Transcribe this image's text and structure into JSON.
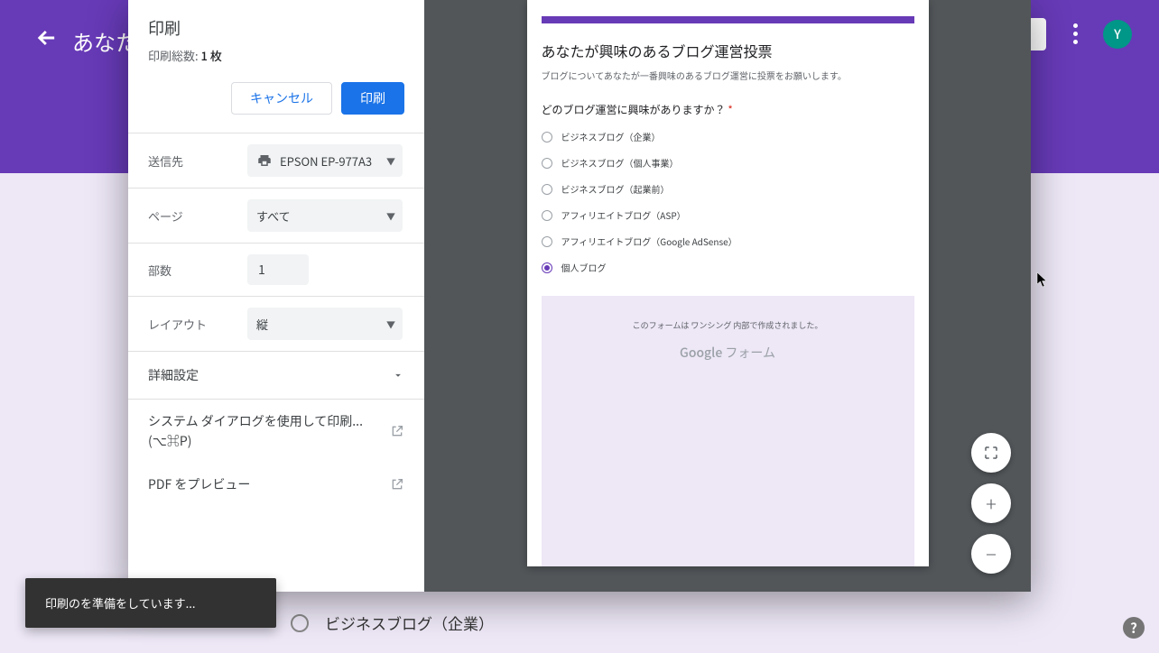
{
  "header": {
    "title": "あなた",
    "avatar_letter": "Y"
  },
  "visible_option": "ビジネスブログ（企業）",
  "toast": "印刷のを準備をしています...",
  "print": {
    "title": "印刷",
    "subtitle_prefix": "印刷総数: ",
    "subtitle_count": "1 枚",
    "cancel": "キャンセル",
    "confirm": "印刷",
    "rows": {
      "destination_label": "送信先",
      "destination_value": "EPSON EP-977A3",
      "pages_label": "ページ",
      "pages_value": "すべて",
      "copies_label": "部数",
      "copies_value": "1",
      "layout_label": "レイアウト",
      "layout_value": "縦"
    },
    "advanced": "詳細設定",
    "system_dialog": "システム ダイアログを使用して印刷...",
    "system_shortcut": "(⌥⌘P)",
    "pdf_preview": "PDF をプレビュー"
  },
  "form": {
    "title": "あなたが興味のあるブログ運営投票",
    "description": "ブログについてあなたが一番興味のあるブログ運営に投票をお願いします。",
    "question": "どのブログ運営に興味がありますか？",
    "options": [
      "ビジネスブログ（企業）",
      "ビジネスブログ（個人事業）",
      "ビジネスブログ（起業前）",
      "アフィリエイトブログ（ASP）",
      "アフィリエイトブログ（Google AdSense）",
      "個人ブログ"
    ],
    "selected_index": 5,
    "footer_line1": "このフォームは ワンシング 内部で作成されました。",
    "footer_brand": "Google",
    "footer_brand2": " フォーム"
  }
}
